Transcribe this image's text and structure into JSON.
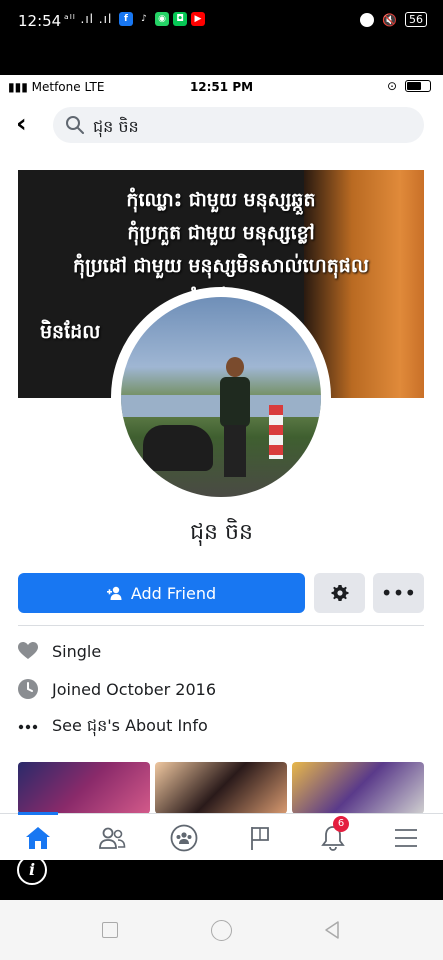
{
  "outer_status": {
    "time": "12:54",
    "signal": "ᵃˡˡ .ıl .ıl",
    "battery": "56",
    "app_icons": [
      {
        "name": "facebook-icon",
        "glyph": "f",
        "color": "#1877f2"
      },
      {
        "name": "tiktok-icon",
        "glyph": "♪",
        "color": "#000000"
      },
      {
        "name": "messenger-icon",
        "glyph": "◉",
        "color": "#25d366"
      },
      {
        "name": "line-icon",
        "glyph": "◘",
        "color": "#06c755"
      },
      {
        "name": "youtube-icon",
        "glyph": "▶",
        "color": "#ff0000"
      }
    ]
  },
  "ios_status": {
    "carrier": "Metfone  LTE",
    "time": "12:51 PM"
  },
  "search": {
    "query": "ជុន ចិន"
  },
  "cover": {
    "lines": [
      "កុំឈ្លោះ ជាមួយ មនុស្សឆ្កួត",
      "កុំប្រកួត ជាមួយ មនុស្សខ្លៅ",
      "កុំប្រដៅ ជាមួយ មនុស្សមិនសាល់ហេតុផល",
      "កុំខ្វល់ ជា",
      "មិនដែល"
    ]
  },
  "profile": {
    "name": "ជុន ចិន"
  },
  "actions": {
    "add_friend_label": "Add Friend",
    "more_label": "•••"
  },
  "intro": {
    "relationship": "Single",
    "joined": "Joined October 2016",
    "about": "See ជុន's About Info"
  },
  "colors": {
    "facebook_blue": "#1877f2",
    "badge_red": "#e41e3f",
    "icon_gray": "#8a8d91"
  },
  "bottom_nav": {
    "notifications_badge": "6"
  }
}
